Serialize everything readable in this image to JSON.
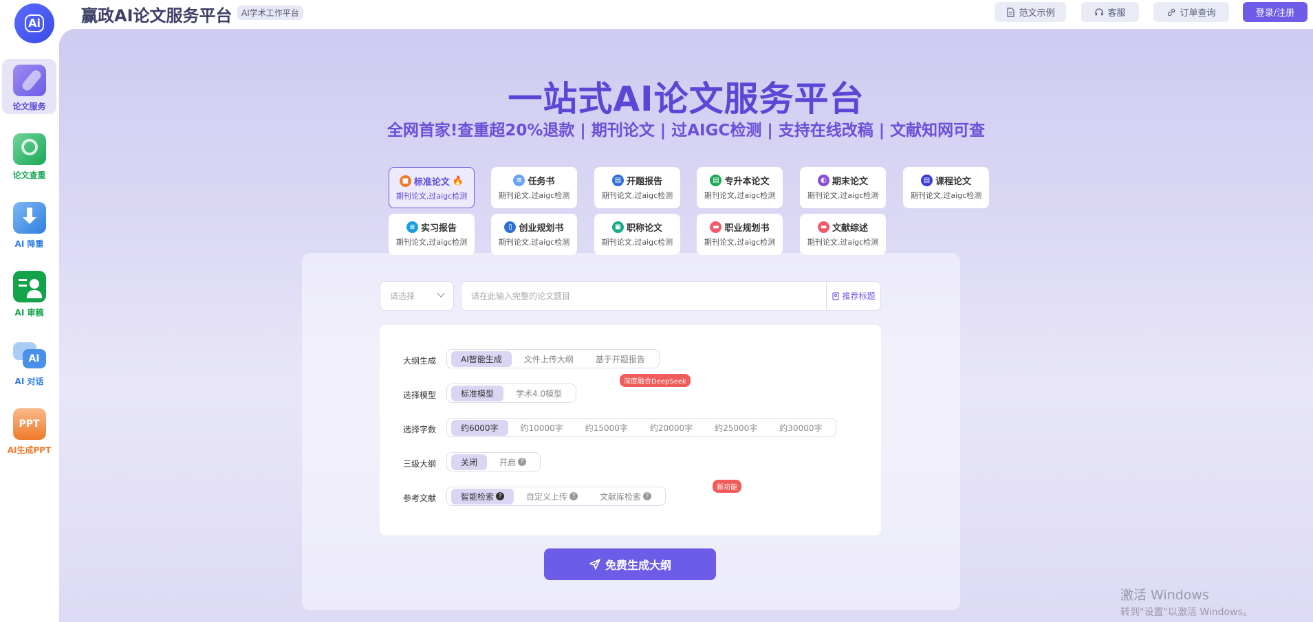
{
  "header": {
    "brand_title": "赢政AI论文服务平台",
    "brand_tag": "AI学术工作平台",
    "logo_text": "Ai",
    "buttons": [
      {
        "label": "范文示例",
        "icon": "document-icon"
      },
      {
        "label": "客服",
        "icon": "headset-icon"
      },
      {
        "label": "订单查询",
        "icon": "link-icon"
      },
      {
        "label": "登录/注册",
        "icon": ""
      }
    ]
  },
  "sidebar": {
    "items": [
      {
        "label": "论文服务",
        "icon": "pen-icon",
        "color": "#5a47d6",
        "active": true
      },
      {
        "label": "论文查重",
        "icon": "magnifier-icon",
        "color": "#1aa856"
      },
      {
        "label": "AI 降重",
        "icon": "download-icon",
        "color": "#2f7fe0"
      },
      {
        "label": "AI 审稿",
        "icon": "reviewer-icon",
        "color": "#15a34a"
      },
      {
        "label": "AI 对话",
        "icon": "chat-icon",
        "color": "#2f7fe0"
      },
      {
        "label": "AI生成PPT",
        "icon": "ppt-icon",
        "color": "#f07a2b"
      }
    ]
  },
  "hero": {
    "title": "一站式AI论文服务平台",
    "subtitle": "全网首家!查重超20%退款 | 期刊论文 | 过AIGC检测 | 支持在线改稿 | 文献知网可查"
  },
  "paper_types": [
    {
      "name": "标准论文",
      "sub": "期刊论文,过aigc检测",
      "color": "#f07a2b",
      "active": true,
      "hot": true
    },
    {
      "name": "任务书",
      "sub": "期刊论文,过aigc检测",
      "color": "#6aa5f0"
    },
    {
      "name": "开题报告",
      "sub": "期刊论文,过aigc检测",
      "color": "#2f6fd6"
    },
    {
      "name": "专升本论文",
      "sub": "期刊论文,过aigc检测",
      "color": "#1aa856"
    },
    {
      "name": "期末论文",
      "sub": "期刊论文,过aigc检测",
      "color": "#8a4fd6"
    },
    {
      "name": "课程论文",
      "sub": "期刊论文,过aigc检测",
      "color": "#3a3ad6"
    },
    {
      "name": "实习报告",
      "sub": "期刊论文,过aigc检测",
      "color": "#1aa0e0"
    },
    {
      "name": "创业规划书",
      "sub": "期刊论文,过aigc检测",
      "color": "#2f6fd6"
    },
    {
      "name": "职称论文",
      "sub": "期刊论文,过aigc检测",
      "color": "#1aa88a"
    },
    {
      "name": "职业规划书",
      "sub": "期刊论文,过aigc检测",
      "color": "#f05b6b"
    },
    {
      "name": "文献综述",
      "sub": "期刊论文,过aigc检测",
      "color": "#f05b6b"
    }
  ],
  "form": {
    "select_placeholder": "请选择",
    "topic_placeholder": "请在此输入完整的论文题目",
    "recommend_label": "推荐标题",
    "rows": [
      {
        "label": "大纲生成",
        "options": [
          "AI智能生成",
          "文件上传大纲",
          "基于开题报告"
        ],
        "selected": 0
      },
      {
        "label": "选择模型",
        "options": [
          "标准模型",
          "学术4.0模型"
        ],
        "selected": 0,
        "tag": "深度融合DeepSeek"
      },
      {
        "label": "选择字数",
        "options": [
          "约6000字",
          "约10000字",
          "约15000字",
          "约20000字",
          "约25000字",
          "约30000字"
        ],
        "selected": 0
      },
      {
        "label": "三级大纲",
        "options": [
          "关闭",
          "开启"
        ],
        "selected": 0
      },
      {
        "label": "参考文献",
        "options": [
          "智能检索",
          "自定义上传",
          "文献库检索"
        ],
        "selected": 0,
        "tag": "新功能"
      }
    ],
    "generate_button": "免费生成大纲"
  },
  "watermark": {
    "line1": "激活 Windows",
    "line2": "转到\"设置\"以激活 Windows。"
  }
}
